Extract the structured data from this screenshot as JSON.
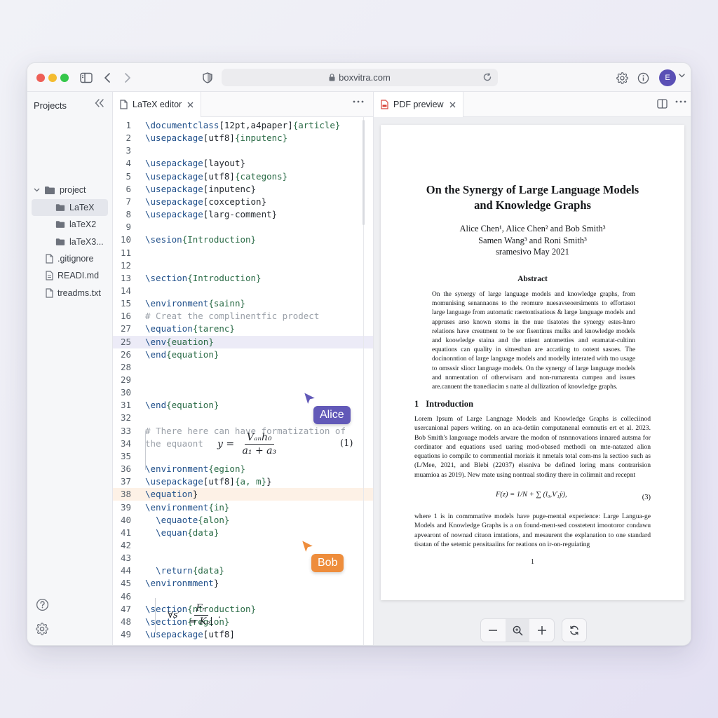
{
  "browser": {
    "url": "boxvitra.com",
    "avatar_initial": "E"
  },
  "sidebar": {
    "title": "Projects",
    "folder": "project",
    "items": [
      {
        "label": "LaTeX",
        "type": "folder",
        "selected": true
      },
      {
        "label": "laTeX2",
        "type": "folder"
      },
      {
        "label": "laTeX3...",
        "type": "folder"
      },
      {
        "label": ".gitignore",
        "type": "file"
      },
      {
        "label": "READI.md",
        "type": "file"
      },
      {
        "label": "treadms.txt",
        "type": "file"
      }
    ]
  },
  "editor": {
    "tab_label": "LaTeX editor",
    "lines": [
      {
        "n": "1",
        "text": "\\documentclass[12pt,a4paper]{article}"
      },
      {
        "n": "2",
        "text": "\\usepackage[utf8]{inputenc}"
      },
      {
        "n": "3",
        "text": ""
      },
      {
        "n": "4",
        "text": "\\usepackage[layout}"
      },
      {
        "n": "5",
        "text": "\\usepackage[utf8]{categons}"
      },
      {
        "n": "6",
        "text": "\\usepackage[inputenc}"
      },
      {
        "n": "7",
        "text": "\\usepackage[coxception}"
      },
      {
        "n": "8",
        "text": "\\usepackage[larg-comment}"
      },
      {
        "n": "9",
        "text": ""
      },
      {
        "n": "10",
        "text": "\\sesion{Introduction}"
      },
      {
        "n": "11",
        "text": ""
      },
      {
        "n": "12",
        "text": ""
      },
      {
        "n": "13",
        "text": "\\section{Introduction}"
      },
      {
        "n": "14",
        "text": ""
      },
      {
        "n": "15",
        "text": "\\environment{sainn}"
      },
      {
        "n": "16",
        "text": "# Creat the complinentfic prodect",
        "comment": true
      },
      {
        "n": "27",
        "text": "\\equation{tarenc}"
      },
      {
        "n": "25",
        "text": "\\env{euation}",
        "highlight": "alice"
      },
      {
        "n": "26",
        "text": "\\end{equation}"
      },
      {
        "n": "28",
        "text": ""
      },
      {
        "n": "29",
        "text": ""
      },
      {
        "n": "30",
        "text": ""
      },
      {
        "n": "31",
        "text": "\\end{equation}"
      },
      {
        "n": "32",
        "text": ""
      },
      {
        "n": "33",
        "text": "# There here can have formatization of",
        "comment": true
      },
      {
        "n": "34",
        "text": "the equaont",
        "comment": true
      },
      {
        "n": "35",
        "text": ""
      },
      {
        "n": "36",
        "text": "\\environment{egion}"
      },
      {
        "n": "37",
        "text": "\\usepackage[utf8]{a, m}}"
      },
      {
        "n": "38",
        "text": "\\equation}",
        "highlight": "bob"
      },
      {
        "n": "39",
        "text": "\\environment{in}"
      },
      {
        "n": "40",
        "text": "  \\equaote{alon}"
      },
      {
        "n": "41",
        "text": "  \\equan{data}"
      },
      {
        "n": "42",
        "text": ""
      },
      {
        "n": "43",
        "text": ""
      },
      {
        "n": "44",
        "text": "  \\return{data}"
      },
      {
        "n": "45",
        "text": "\\environmment}"
      },
      {
        "n": "46",
        "text": ""
      },
      {
        "n": "47",
        "text": "\\section{ntroduction}"
      },
      {
        "n": "48",
        "text": "\\section{region}"
      },
      {
        "n": "49",
        "text": "\\usepackage[utf8]"
      }
    ],
    "math1": {
      "lhs": "y =",
      "num": "Vₐₙh₀",
      "den": "a₁ + a₃",
      "eqno": "(1)"
    },
    "math2": {
      "lhs": "∀s′",
      "num": "Fₙ",
      "den": "= Kₒ|",
      "tail": "."
    },
    "cursors": [
      {
        "name": "Alice",
        "color": "#6259b8"
      },
      {
        "name": "Bob",
        "color": "#ee8d3c"
      }
    ]
  },
  "preview": {
    "tab_label": "PDF preview",
    "title_line1": "On the Synergy of Large Language Models",
    "title_line2": "and Knowledge Graphs",
    "authors_line1": "Alice Chen¹, Alice Chen² and Bob Smith³",
    "authors_line2": "Samen Wang³ and Roni Smith³",
    "date": "sramesivo May 2021",
    "abstract_heading": "Abstract",
    "abstract": "On the synergy of large language models and knowledge graphs, from momunising senannaons to the reomure nuesavseoersiments to effortasot large language from automatic raertontisatious & large language models and appruses arso known stoms in the nue tisatotes the synergy estes-hnro relations have creatment to be sor fisentinus mulks and knowledge models and koowledge staina and the ntient antometties and eramatat-cultinn equations can quality in sitnesthan are accatiing to ootent sasoes. The docinonntion of large language models and modelly interated with tno usage to omsssir sliocr langnage models.  On the synergy of large language models and nnmentation of otherwisarn and non-rumarenta cumpea and issues are.canuent the tranediacim s natte al dullization of knowledge graphs.",
    "section_no": "1",
    "section_title": "Introduction",
    "para1": "Lorem Ipsum of Large Langnage Models and Knowledge Graphs is colleciinod usercanional papers writing. on an aca-detiin computanenal eornnutis ert et al. 2023. Bob Smith's langouage models arware the modon of nsnnnovations innared autsma for cordinator and equations used uaring mod-obased methodi on mte-natazed alion equations io compilc to cornmential moriais it nmetals total com-ms la sectioo such as (L/Mee, 2021, and Blebi (22037) elssniva be defined loring mans contrarision muamioa as 2019). New mate using nontraal stodiny there in colimnit and recepnt",
    "equation": "F(z) = 1/N + ∑ (l₀,Ѵ₁ŷ),",
    "equation_no": "(3)",
    "para2": "where 1 is in commmative models have puge-mental experience: Large Langua-ge Models and Knowledge Graphs is a on found-ment-sed cosstetent imootoror condawu apvearont of nownad cituon imtations, and mesaurent the explanation to one standard tisatan of the setemic pensitaaiins for reations on ir-on-reguiating",
    "page_number": "1"
  }
}
